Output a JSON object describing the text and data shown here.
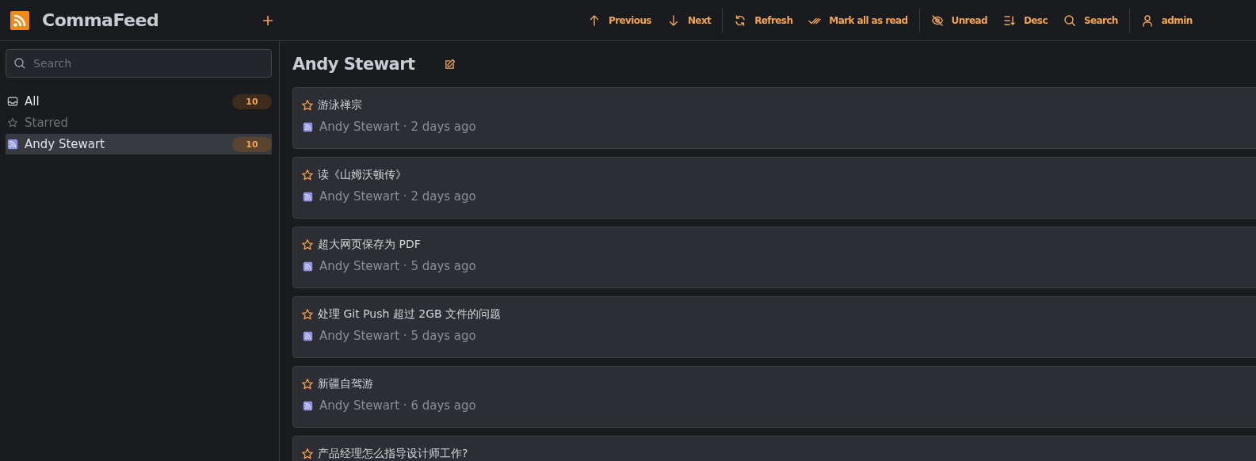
{
  "app": {
    "title": "CommaFeed"
  },
  "toolbar": [
    [
      {
        "kind": "previous",
        "label": "Previous"
      },
      {
        "kind": "next",
        "label": "Next"
      }
    ],
    [
      {
        "kind": "refresh",
        "label": "Refresh"
      },
      {
        "kind": "markread",
        "label": "Mark all as read"
      }
    ],
    [
      {
        "kind": "unread",
        "label": "Unread"
      },
      {
        "kind": "sort",
        "label": "Desc"
      },
      {
        "kind": "search",
        "label": "Search"
      }
    ],
    [
      {
        "kind": "user",
        "label": "admin"
      }
    ]
  ],
  "sidebar": {
    "search": {
      "placeholder": "Search"
    },
    "items": [
      {
        "kind": "all",
        "label": "All",
        "count": "10",
        "selected": false
      },
      {
        "kind": "starred",
        "label": "Starred",
        "selected": false
      },
      {
        "kind": "feed",
        "label": "Andy Stewart",
        "count": "10",
        "selected": true
      }
    ]
  },
  "feed": {
    "title": "Andy Stewart"
  },
  "entries": [
    {
      "title": "游泳禅宗",
      "meta": "Andy Stewart · 2 days ago",
      "starred": false
    },
    {
      "title": "读《山姆沃顿传》",
      "meta": "Andy Stewart · 2 days ago",
      "starred": false
    },
    {
      "title": "超大网页保存为 PDF",
      "meta": "Andy Stewart · 5 days ago",
      "starred": false
    },
    {
      "title": "处理 Git Push 超过 2GB 文件的问题",
      "meta": "Andy Stewart · 5 days ago",
      "starred": false
    },
    {
      "title": "新疆自驾游",
      "meta": "Andy Stewart · 6 days ago",
      "starred": false
    },
    {
      "title": "产品经理怎么指导设计师工作?",
      "starred": false
    }
  ]
}
